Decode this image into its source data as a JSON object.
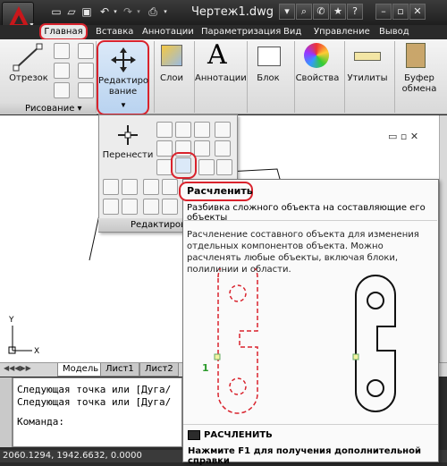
{
  "window": {
    "title": "Чертеж1.dwg",
    "win_buttons": [
      "▾",
      "⌕",
      "✆",
      "★",
      "?",
      "–",
      "▫",
      "✕"
    ]
  },
  "tabs": [
    "Главная",
    "Вставка",
    "Аннотации",
    "Параметризация",
    "Вид",
    "Управление",
    "Вывод"
  ],
  "ribbon": {
    "line": "Отрезок",
    "draw_panel": "Рисование",
    "modify_line1": "Редактиро",
    "modify_line2": "вание",
    "layers": "Слои",
    "annotations": "Аннотации",
    "block": "Блок",
    "properties": "Свойства",
    "utilities": "Утилиты",
    "clipboard_line1": "Буфер",
    "clipboard_line2": "обмена"
  },
  "dropdown": {
    "move_label": "Перенести",
    "panel_label": "Редактирова"
  },
  "tooltip": {
    "title": "Расчленить",
    "short": "Разбивка сложного объекта на составляющие его объекты",
    "description": "Расчленение составного объекта для изменения отдельных компонентов объекта. Можно расчленять любые объекты, включая блоки, полилинии и области.",
    "callout_number": "1",
    "command": "РАСЧЛЕНИТЬ",
    "help": "Нажмите F1 для получения дополнительной справки"
  },
  "layout_tabs": [
    "Модель",
    "Лист1",
    "Лист2"
  ],
  "command_line": {
    "lines": [
      "Следующая точка или [Дуга/",
      "Следующая точка или [Дуга/",
      "Команда:"
    ]
  },
  "axes": {
    "y": "Y",
    "x": "X"
  },
  "status": {
    "coords": "2060.1294, 1942.6632, 0.0000"
  },
  "colors": {
    "accent_red": "#d9232d",
    "ribbon_blue": "#b9d3f0"
  }
}
